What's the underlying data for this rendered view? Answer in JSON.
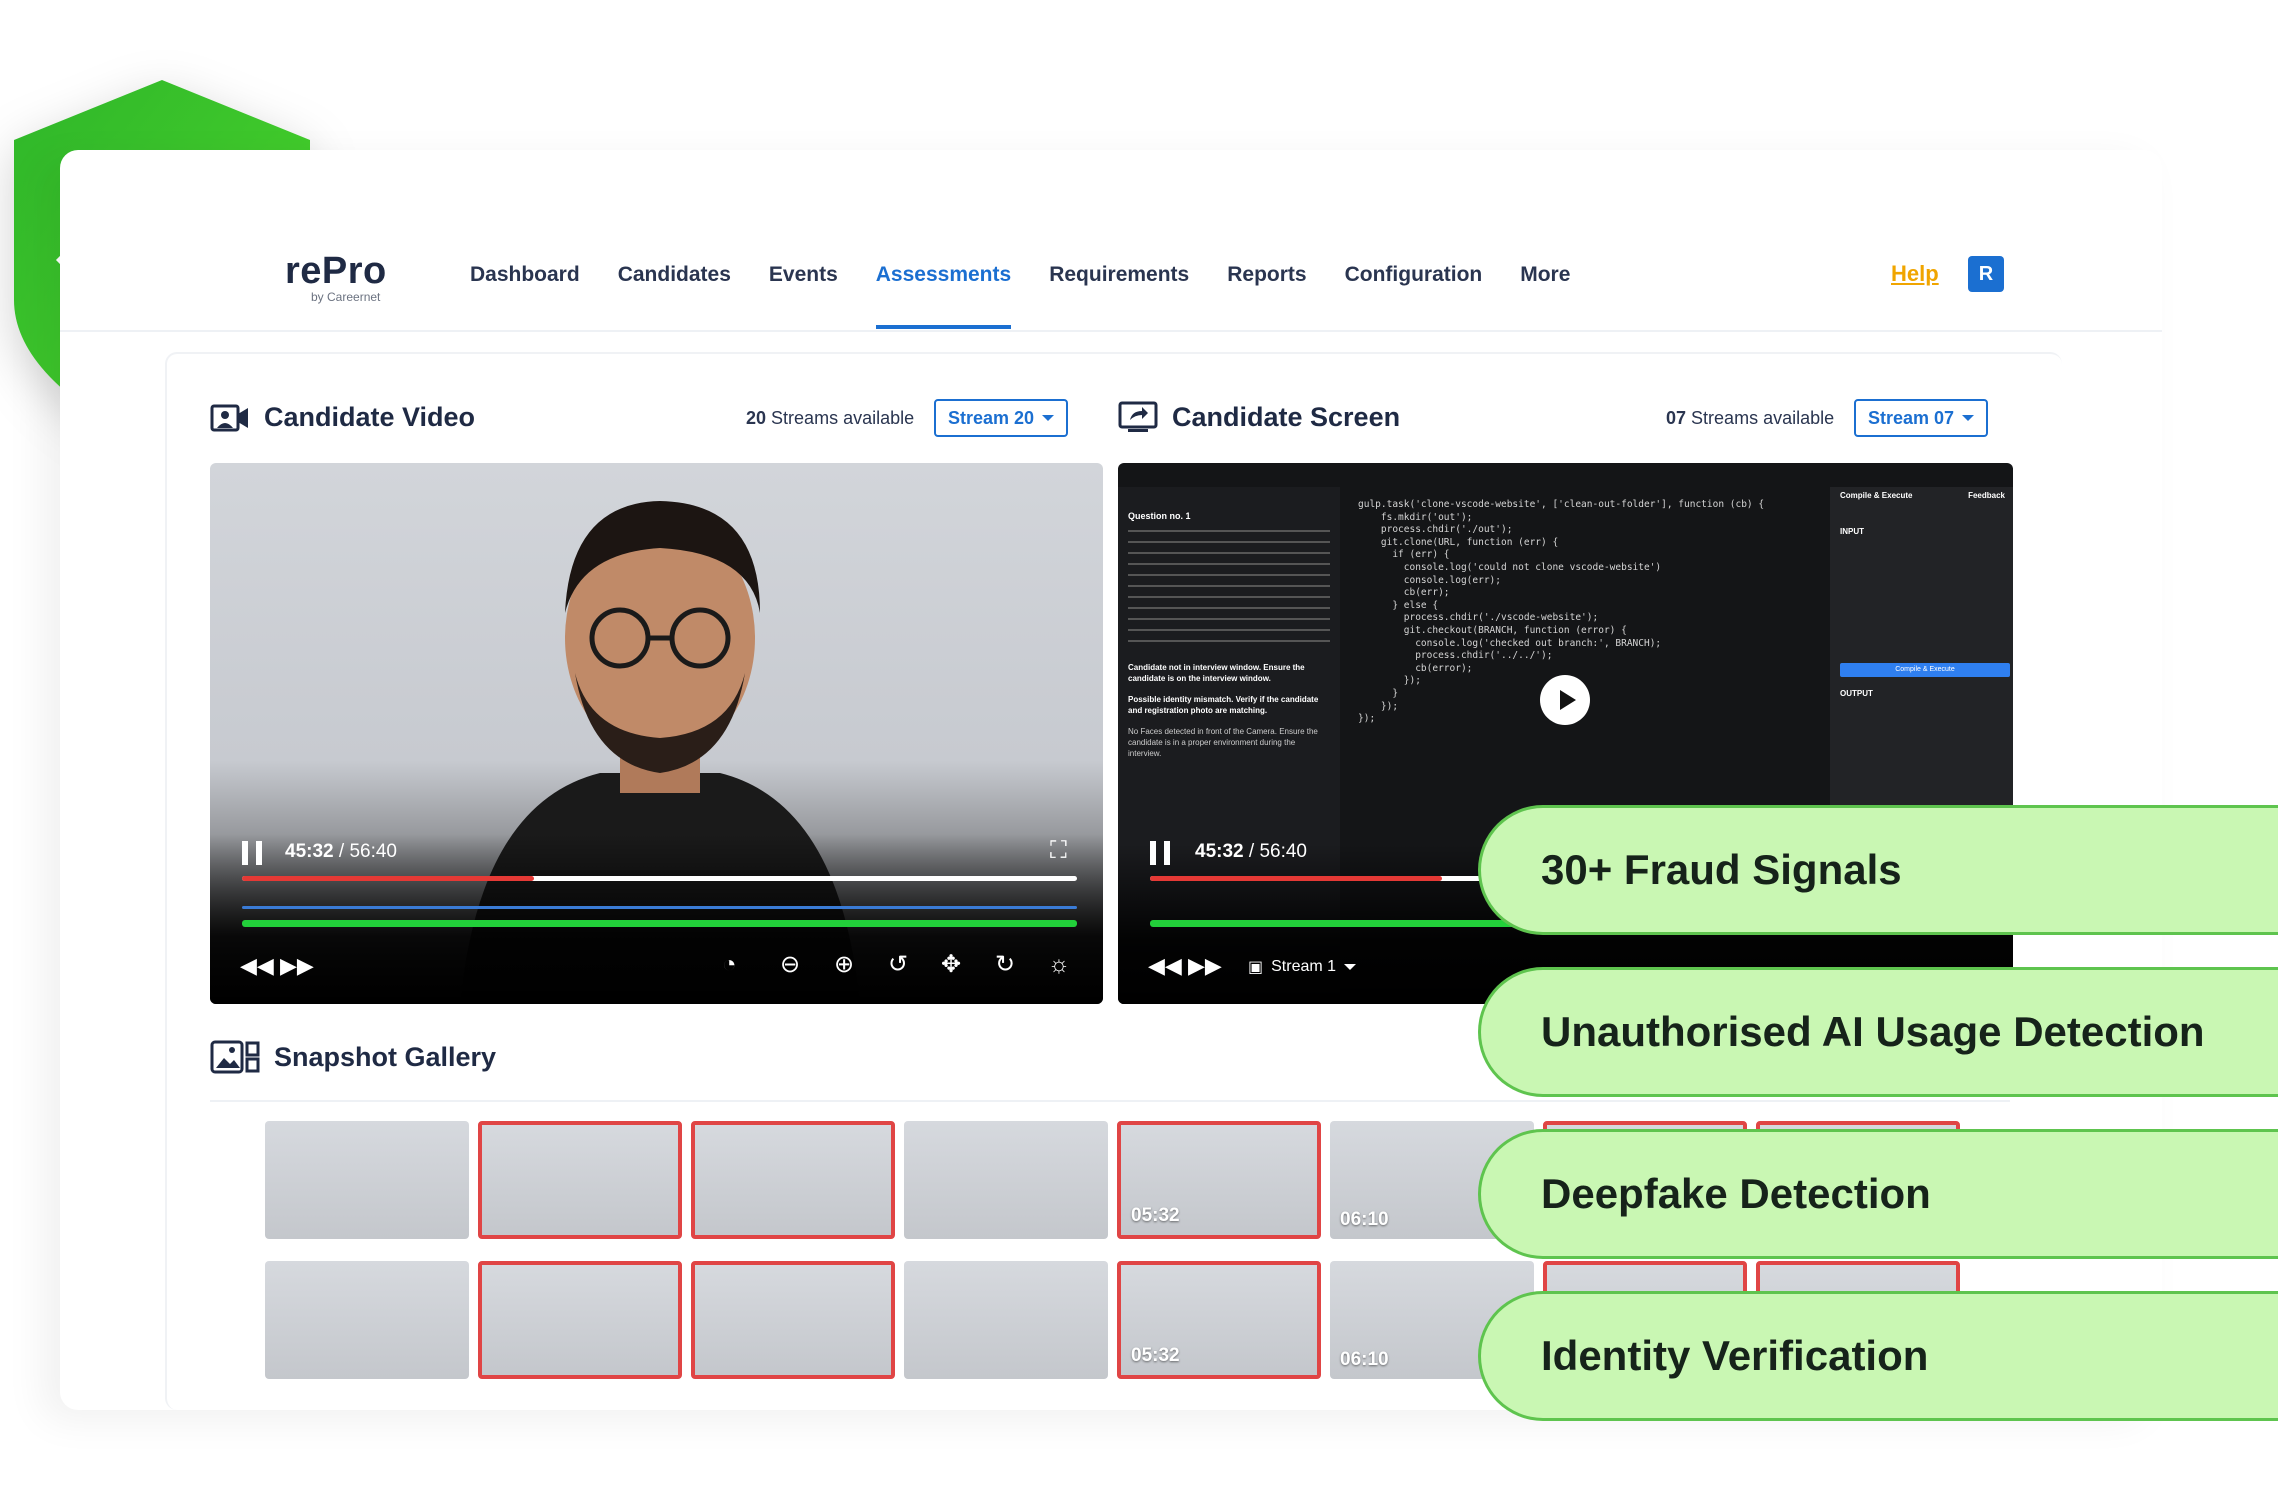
{
  "brand": {
    "name": "rePro",
    "sub": "by Careernet"
  },
  "nav": {
    "items": [
      "Dashboard",
      "Candidates",
      "Events",
      "Assessments",
      "Requirements",
      "Reports",
      "Configuration",
      "More"
    ],
    "active": "Assessments",
    "help": "Help",
    "avatar": "R"
  },
  "video_panel": {
    "title": "Candidate Video",
    "streams_count": "20",
    "streams_text": "Streams available",
    "stream_select": "Stream 20",
    "time_current": "45:32",
    "time_total": "/ 56:40",
    "progress": 0.35
  },
  "screen_panel": {
    "title": "Candidate Screen",
    "streams_count": "07",
    "streams_text": "Streams available",
    "stream_select": "Stream 07",
    "time_current": "45:32",
    "time_total": "/ 56:40",
    "stream_label": "Stream 1",
    "question_title": "Question no. 1",
    "compile_label": "Compile & Execute",
    "feedback_label": "Feedback",
    "input_label": "INPUT",
    "output_label": "OUTPUT",
    "alerts": [
      "Candidate not in interview window. Ensure the candidate is on the interview window.",
      "Possible identity mismatch. Verify if the candidate and registration photo are matching.",
      "No Faces detected in front of the Camera. Ensure the candidate is in a proper environment during the interview."
    ]
  },
  "gallery": {
    "title": "Snapshot Gallery",
    "timestamps": [
      "05:32",
      "06:10"
    ]
  },
  "callouts": [
    "30+ Fraud Signals",
    "Unauthorised AI Usage Detection",
    "Deepfake Detection",
    "Identity Verification"
  ],
  "colors": {
    "accent": "#1b6fd1",
    "help": "#f0a500",
    "flag": "#e04545",
    "callout_bg": "#c9f7b3",
    "callout_border": "#5ec44e",
    "shield": "#33c12a"
  }
}
